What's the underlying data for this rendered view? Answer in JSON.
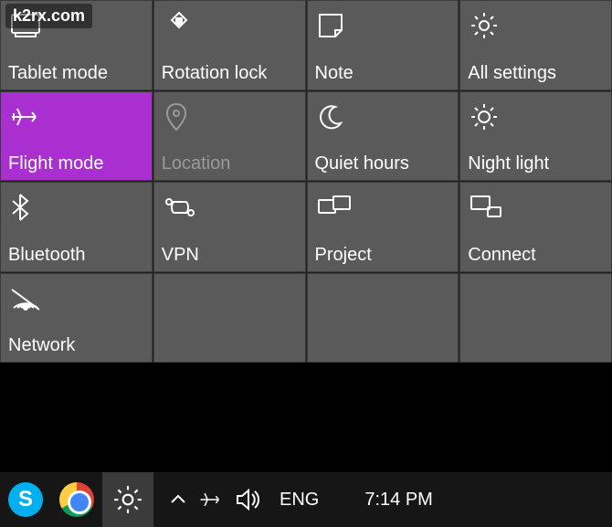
{
  "watermark": "k2rx.com",
  "tiles": [
    {
      "id": "tablet-mode",
      "label": "Tablet mode",
      "active": false,
      "icon": "tablet"
    },
    {
      "id": "rotation-lock",
      "label": "Rotation lock",
      "active": false,
      "icon": "rotation-lock"
    },
    {
      "id": "note",
      "label": "Note",
      "active": false,
      "icon": "note"
    },
    {
      "id": "all-settings",
      "label": "All settings",
      "active": false,
      "icon": "gear"
    },
    {
      "id": "flight-mode",
      "label": "Flight mode",
      "active": true,
      "icon": "airplane"
    },
    {
      "id": "location",
      "label": "Location",
      "active": false,
      "disabled": true,
      "icon": "location"
    },
    {
      "id": "quiet-hours",
      "label": "Quiet hours",
      "active": false,
      "icon": "moon"
    },
    {
      "id": "night-light",
      "label": "Night light",
      "active": false,
      "icon": "sun"
    },
    {
      "id": "bluetooth",
      "label": "Bluetooth",
      "active": false,
      "icon": "bluetooth"
    },
    {
      "id": "vpn",
      "label": "VPN",
      "active": false,
      "icon": "vpn"
    },
    {
      "id": "project",
      "label": "Project",
      "active": false,
      "icon": "project"
    },
    {
      "id": "connect",
      "label": "Connect",
      "active": false,
      "icon": "connect"
    },
    {
      "id": "network",
      "label": "Network",
      "active": false,
      "icon": "network"
    }
  ],
  "taskbar": {
    "apps": [
      {
        "id": "skype",
        "name": "Skype"
      },
      {
        "id": "chrome",
        "name": "Chrome"
      },
      {
        "id": "settings",
        "name": "Settings",
        "active": true
      }
    ],
    "tray": {
      "chevron": "up",
      "airplane": true,
      "volume": true,
      "language": "ENG",
      "time": "7:14 PM"
    }
  },
  "colors": {
    "tile_bg": "#5a5a5a",
    "tile_active": "#a92fd1",
    "taskbar": "#161616"
  }
}
